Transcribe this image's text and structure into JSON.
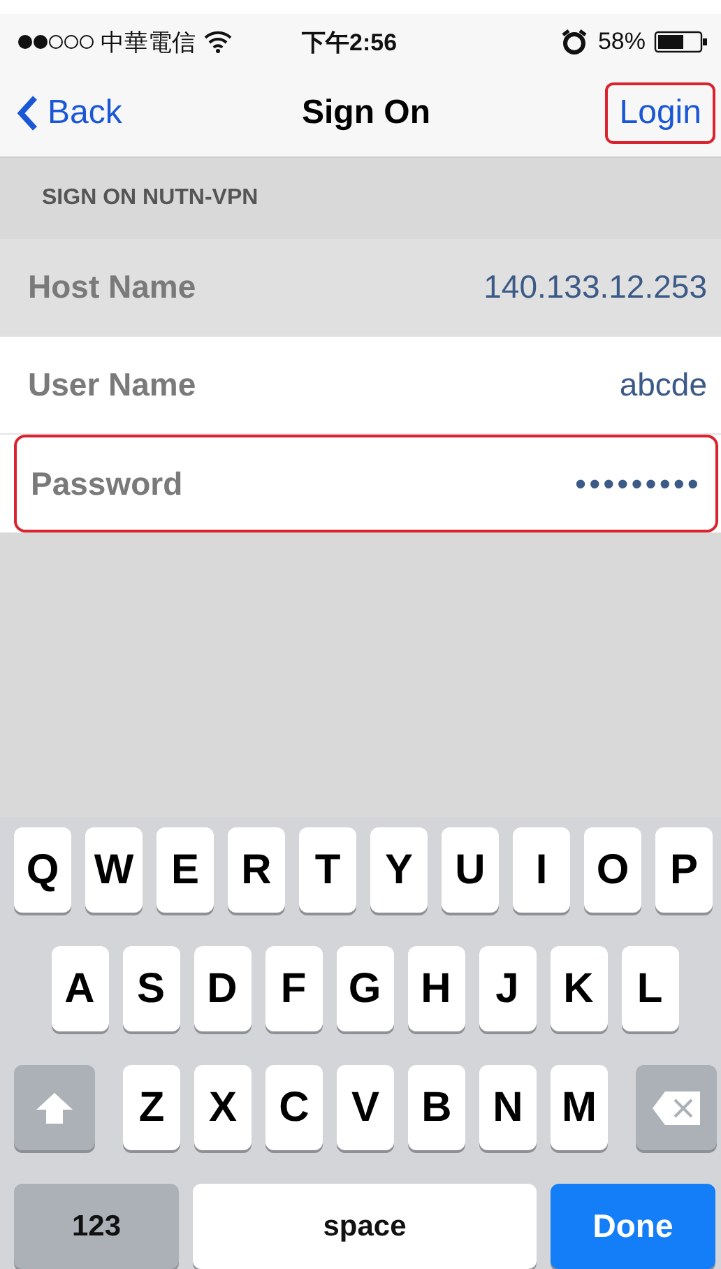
{
  "status_bar": {
    "carrier": "中華電信",
    "time": "下午2:56",
    "battery": "58%"
  },
  "nav": {
    "back": "Back",
    "title": "Sign On",
    "action": {
      "label": "Login",
      "highlighted": true
    }
  },
  "section": {
    "header": "SIGN ON NUTN-VPN",
    "rows": [
      {
        "label": "Host Name",
        "value": "140.133.12.253",
        "disabled": true,
        "highlighted": false
      },
      {
        "label": "User Name",
        "value": "abcde",
        "disabled": false,
        "highlighted": false
      },
      {
        "label": "Password",
        "value": "•••••••••",
        "disabled": false,
        "highlighted": true
      }
    ]
  },
  "keyboard": {
    "rows": [
      {
        "keys": [
          {
            "kind": "letter",
            "label": "Q"
          },
          {
            "kind": "letter",
            "label": "W"
          },
          {
            "kind": "letter",
            "label": "E"
          },
          {
            "kind": "letter",
            "label": "R"
          },
          {
            "kind": "letter",
            "label": "T"
          },
          {
            "kind": "letter",
            "label": "Y"
          },
          {
            "kind": "letter",
            "label": "U"
          },
          {
            "kind": "letter",
            "label": "I"
          },
          {
            "kind": "letter",
            "label": "O"
          },
          {
            "kind": "letter",
            "label": "P"
          }
        ]
      },
      {
        "keys": [
          {
            "kind": "letter",
            "label": "A"
          },
          {
            "kind": "letter",
            "label": "S"
          },
          {
            "kind": "letter",
            "label": "D"
          },
          {
            "kind": "letter",
            "label": "F"
          },
          {
            "kind": "letter",
            "label": "G"
          },
          {
            "kind": "letter",
            "label": "H"
          },
          {
            "kind": "letter",
            "label": "J"
          },
          {
            "kind": "letter",
            "label": "K"
          },
          {
            "kind": "letter",
            "label": "L"
          }
        ]
      },
      {
        "keys": [
          {
            "kind": "shift"
          },
          {
            "kind": "letter",
            "label": "Z"
          },
          {
            "kind": "letter",
            "label": "X"
          },
          {
            "kind": "letter",
            "label": "C"
          },
          {
            "kind": "letter",
            "label": "V"
          },
          {
            "kind": "letter",
            "label": "B"
          },
          {
            "kind": "letter",
            "label": "N"
          },
          {
            "kind": "letter",
            "label": "M"
          },
          {
            "kind": "delete"
          }
        ]
      },
      {
        "keys": [
          {
            "kind": "mode",
            "label": "123"
          },
          {
            "kind": "space",
            "label": "space"
          },
          {
            "kind": "done",
            "label": "Done"
          }
        ]
      }
    ]
  }
}
